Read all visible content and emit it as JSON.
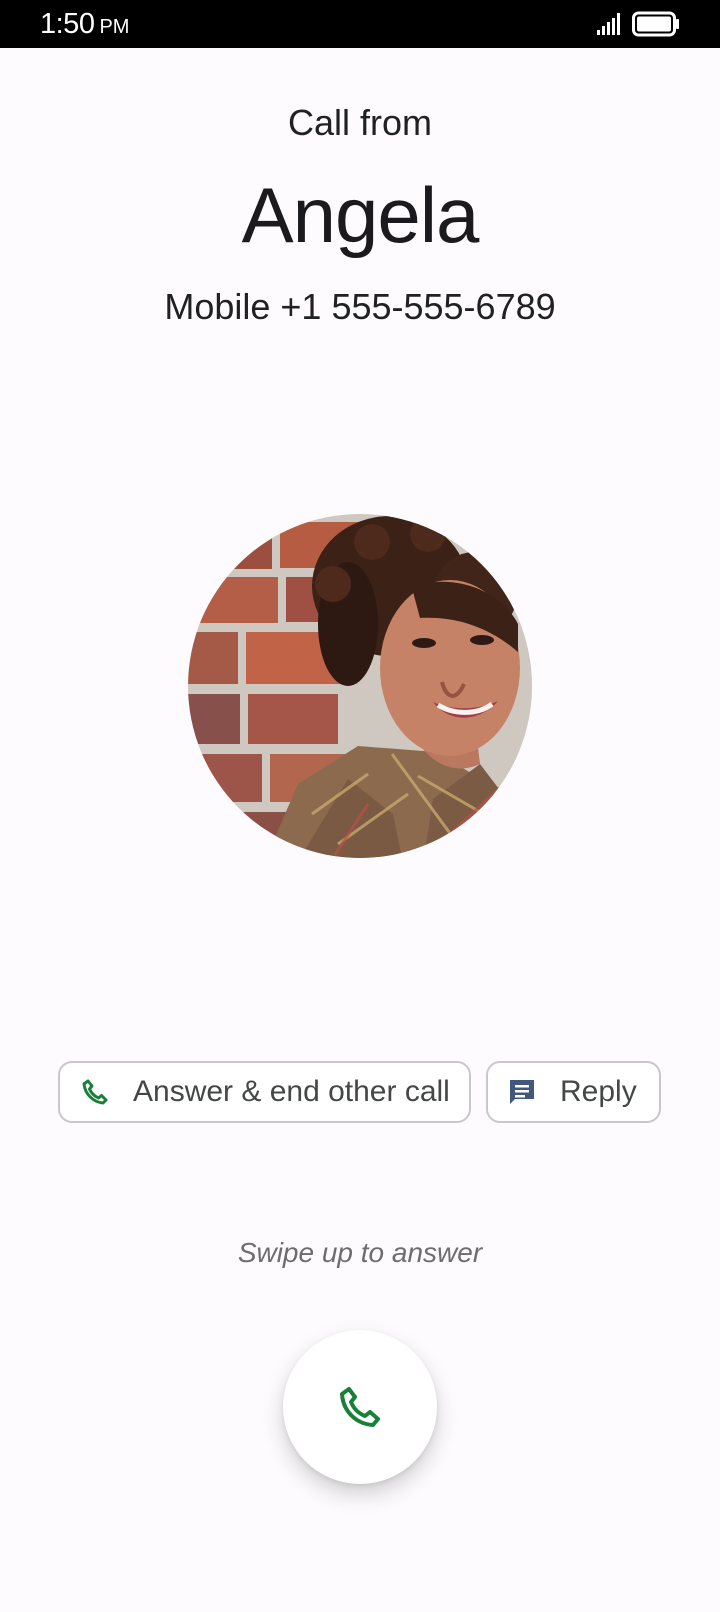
{
  "status_bar": {
    "time": "1:50",
    "ampm": "PM",
    "signal_icon": "cellular-signal-icon",
    "battery_icon": "battery-full-icon"
  },
  "caller": {
    "label": "Call from",
    "name": "Angela",
    "number_line": "Mobile +1 555-555-6789",
    "avatar_icon": "contact-photo"
  },
  "actions": {
    "answer_end_label": "Answer & end other call",
    "reply_label": "Reply",
    "answer_icon": "phone-icon",
    "reply_icon": "message-icon"
  },
  "answer": {
    "hint": "Swipe up to answer",
    "button_icon": "phone-icon"
  },
  "colors": {
    "status_bar": "#000000",
    "background": "#fdfbfd",
    "answer_green": "#188038",
    "reply_icon": "#41577d",
    "chip_border": "#c9c7cc"
  }
}
